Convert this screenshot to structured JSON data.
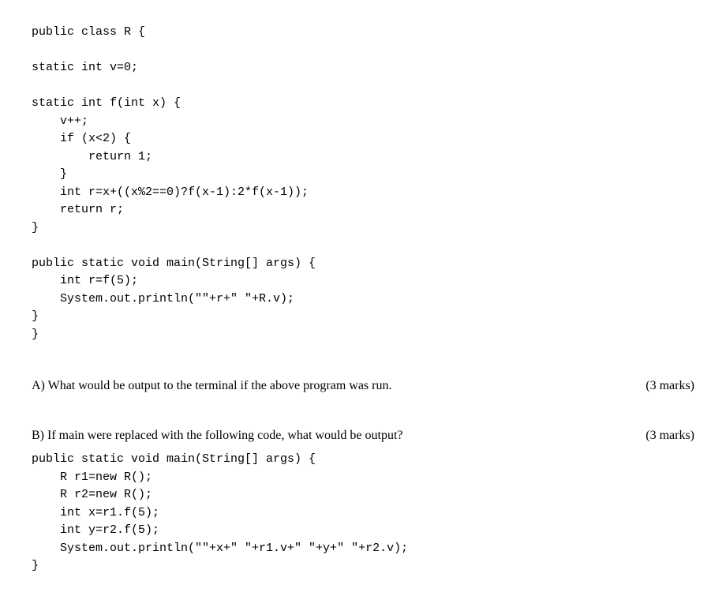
{
  "code1": "public class R {\n\nstatic int v=0;\n\nstatic int f(int x) {\n    v++;\n    if (x<2) {\n        return 1;\n    }\n    int r=x+((x%2==0)?f(x-1):2*f(x-1));\n    return r;\n}\n\npublic static void main(String[] args) {\n    int r=f(5);\n    System.out.println(\"\"+r+\" \"+R.v);\n}\n}",
  "questionA": {
    "text": "A) What would be output to the terminal if the above program was run.",
    "marks": "(3 marks)"
  },
  "questionB": {
    "text": "B) If main were replaced with the following code, what would be output?",
    "marks": "(3 marks)"
  },
  "code2": "public static void main(String[] args) {\n    R r1=new R();\n    R r2=new R();\n    int x=r1.f(5);\n    int y=r2.f(5);\n    System.out.println(\"\"+x+\" \"+r1.v+\" \"+y+\" \"+r2.v);\n}"
}
